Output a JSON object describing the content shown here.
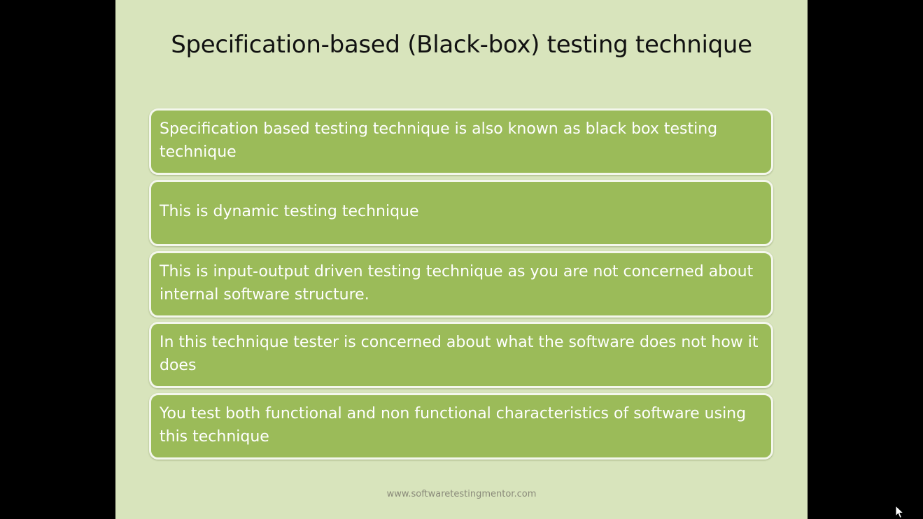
{
  "slide": {
    "title": "Specification-based (Black-box) testing technique",
    "points": [
      {
        "text": "Specification based testing technique is also known as black box testing technique"
      },
      {
        "text": "This is dynamic testing technique"
      },
      {
        "text": "This is input-output driven testing technique as you are not concerned about internal software structure."
      },
      {
        "text": "In this technique tester is concerned about what the software does not how it does"
      },
      {
        "text": "You test both functional and non functional characteristics of software using this technique"
      }
    ],
    "footer": "www.softwaretestingmentor.com"
  },
  "colors": {
    "background": "#000000",
    "slide_background": "#d8e4bc",
    "box_fill": "#9bbb59",
    "box_border": "#f4f7ec",
    "box_text": "#ffffff",
    "title_text": "#111111"
  },
  "icons": {
    "cursor": "mouse-pointer-icon"
  }
}
